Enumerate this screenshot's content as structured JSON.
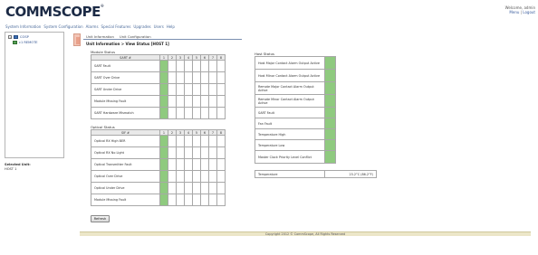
{
  "header": {
    "logo": "COMMSCOPE",
    "logo_mark": "®",
    "menu": [
      "System Information",
      "System Configuration",
      "Alarms",
      "Special Features",
      "Upgrades",
      "Users",
      "Help"
    ],
    "welcome": "Welcome, admin",
    "links": [
      "Menu",
      "Logout"
    ]
  },
  "tree": {
    "root": {
      "label": "COSP"
    },
    "child": {
      "label": "c1 REMOTE"
    }
  },
  "selected_unit": {
    "title": "Selected Unit:",
    "value": "HOST 1"
  },
  "tabs": [
    "Unit Information",
    "Unit Configuration"
  ],
  "breadcrumb": "Unit Information > View Status [HOST 1]",
  "module_status": {
    "title": "Module Status",
    "header": "SART #",
    "slots": [
      "1",
      "2",
      "3",
      "4",
      "5",
      "6",
      "7",
      "8"
    ],
    "rows": [
      "SART Fault",
      "SART Over Drive",
      "SART Under Drive",
      "Module Missing Fault",
      "SART Hardware Mismatch"
    ],
    "green_slots": [
      0
    ]
  },
  "optical_status": {
    "title": "Optical Status",
    "header": "SIF #",
    "slots": [
      "1",
      "2",
      "3",
      "4",
      "5",
      "6",
      "7",
      "8"
    ],
    "rows": [
      "Optical RX High BER",
      "Optical RX No Light",
      "Optical Transmitter Fault",
      "Optical Over Drive",
      "Optical Under Drive",
      "Module Missing Fault"
    ],
    "green_slots": [
      0
    ]
  },
  "host_status": {
    "title": "Host Status",
    "rows": [
      "Host Major Contact Alarm Output Active",
      "Host Minor Contact Alarm Output Active",
      "Remote Major Contact Alarm Output Active",
      "Remote Minor Contact Alarm Output Active",
      "SART Fault",
      "Fan Fault",
      "Temperature High",
      "Temperature Low",
      "Master Clock Priority Level Conflict"
    ],
    "temperature_label": "Temperature",
    "temperature_value": "23.2°C (86.2°F)"
  },
  "refresh_label": "Refresh",
  "footer": "Copyright 2012 © CommScope, All Rights Reserved",
  "colors": {
    "ok": "#8fca7f",
    "footer_bg": "#ece6c8",
    "logo": "#1b2a45"
  }
}
